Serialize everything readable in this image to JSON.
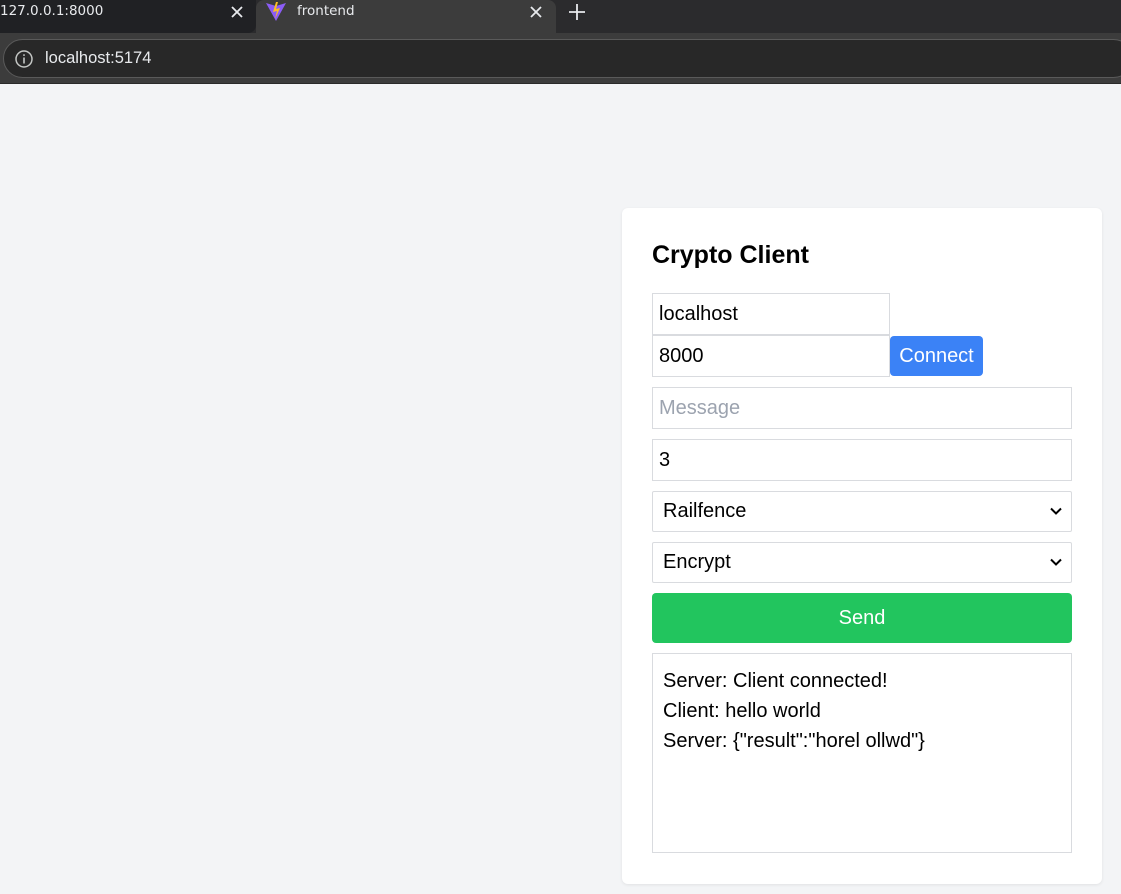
{
  "browser": {
    "tabs": [
      {
        "title": "127.0.0.1:8000",
        "active": false
      },
      {
        "title": "frontend",
        "active": true
      }
    ],
    "address": "localhost:5174"
  },
  "app": {
    "title": "Crypto Client",
    "host_value": "localhost",
    "port_value": "8000",
    "connect_label": "Connect",
    "message_placeholder": "Message",
    "message_value": "",
    "key_value": "3",
    "cipher_selected": "Railfence",
    "mode_selected": "Encrypt",
    "send_label": "Send",
    "log": [
      "Server: Client connected!",
      "Client: hello world",
      "Server: {\"result\":\"horel ollwd\"}"
    ]
  },
  "colors": {
    "page_bg": "#f3f4f6",
    "connect": "#3b82f6",
    "send": "#22c55e"
  }
}
